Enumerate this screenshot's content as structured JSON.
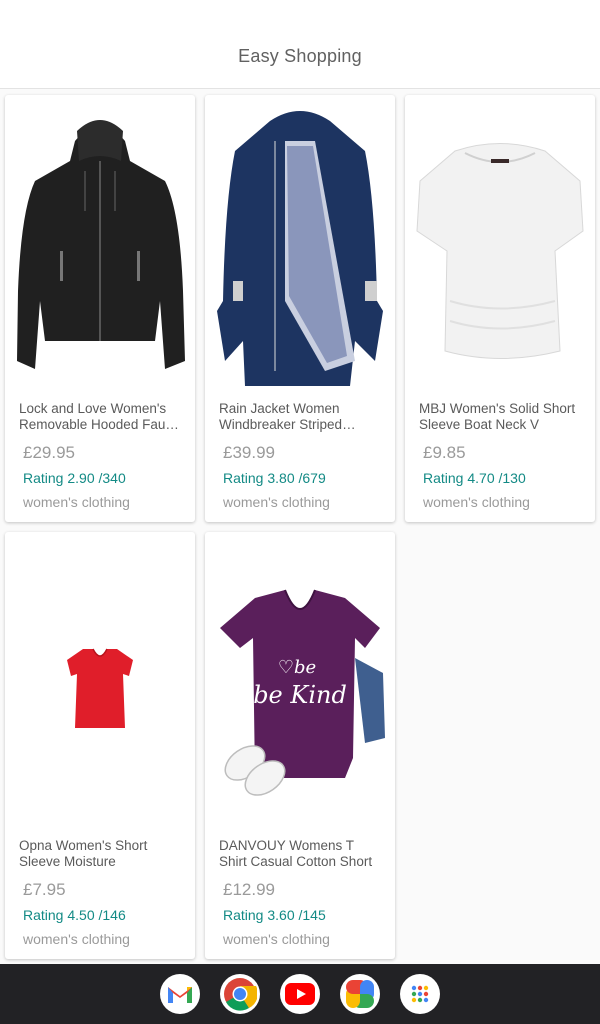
{
  "header": {
    "title": "Easy Shopping"
  },
  "products": [
    {
      "name": "Lock and Love Women's Removable Hooded Faux Leather Jacket",
      "price": "£29.95",
      "rating": "Rating 2.90 /340",
      "category": "women's clothing",
      "image": "black-leather-jacket"
    },
    {
      "name": "Rain Jacket Women Windbreaker Striped Climbing Raincoat",
      "price": "£39.99",
      "rating": "Rating 3.80 /679",
      "category": "women's clothing",
      "image": "navy-rain-jacket"
    },
    {
      "name": "MBJ Women's Solid Short Sleeve Boat Neck V",
      "price": "£9.85",
      "rating": "Rating 4.70 /130",
      "category": "women's clothing",
      "image": "white-boat-neck-top"
    },
    {
      "name": "Opna Women's Short Sleeve Moisture",
      "price": "£7.95",
      "rating": "Rating 4.50 /146",
      "category": "women's clothing",
      "image": "red-vneck-tee"
    },
    {
      "name": "DANVOUY Womens T Shirt Casual Cotton Short",
      "price": "£12.99",
      "rating": "Rating 3.60 /145",
      "category": "women's clothing",
      "image": "purple-be-kind-tee",
      "print_text": "be Kind"
    }
  ],
  "dock": [
    {
      "app": "Gmail",
      "icon": "gmail-icon"
    },
    {
      "app": "Chrome",
      "icon": "chrome-icon"
    },
    {
      "app": "YouTube",
      "icon": "youtube-icon"
    },
    {
      "app": "Photos",
      "icon": "photos-icon"
    },
    {
      "app": "App Drawer",
      "icon": "app-drawer-icon"
    }
  ],
  "colors": {
    "rating": "#138a85",
    "price": "#9a9a9a",
    "dock": "#222225"
  }
}
